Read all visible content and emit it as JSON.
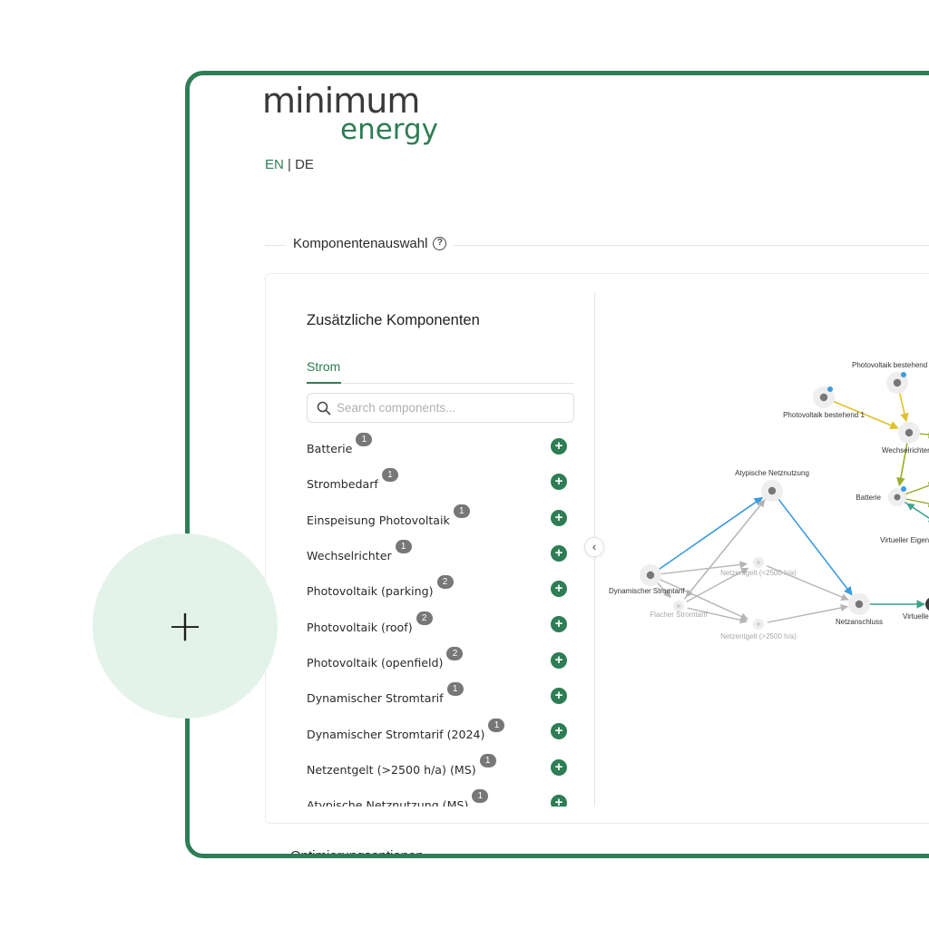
{
  "logo": {
    "line1": "minimum",
    "line2": "energy"
  },
  "language": {
    "en": "EN",
    "separator": " | ",
    "de": "DE"
  },
  "section": {
    "title": "Komponentenauswahl",
    "help_icon": "?"
  },
  "panel": {
    "title": "Zusätzliche Komponenten",
    "tabs": [
      {
        "label": "Strom",
        "active": true
      }
    ],
    "search_placeholder": "Search components...",
    "components": [
      {
        "name": "Batterie",
        "count": "1"
      },
      {
        "name": "Strombedarf",
        "count": "1"
      },
      {
        "name": "Einspeisung Photovoltaik",
        "count": "1"
      },
      {
        "name": "Wechselrichter",
        "count": "1"
      },
      {
        "name": "Photovoltaik (parking)",
        "count": "2"
      },
      {
        "name": "Photovoltaik (roof)",
        "count": "2"
      },
      {
        "name": "Photovoltaik (openfield)",
        "count": "2"
      },
      {
        "name": "Dynamischer Stromtarif",
        "count": "1"
      },
      {
        "name": "Dynamischer Stromtarif (2024)",
        "count": "1"
      },
      {
        "name": "Netzentgelt (>2500 h/a) (MS)",
        "count": "1"
      },
      {
        "name": "Atypische Netznutzung (MS)",
        "count": "1"
      }
    ],
    "collapse_icon": "‹"
  },
  "graph": {
    "nodes": {
      "pv_bestehend": "Photovoltaik bestehend",
      "pv_bestehend_1": "Photovoltaik bestehend 1",
      "wechselrichter": "Wechselrichter",
      "batterie": "Batterie",
      "atypische": "Atypische Netznutzung",
      "virtueller_eigen": "Virtueller Eigen",
      "netzentgelt_low": "Netzentgelt (<2500 h/a)",
      "dynamischer": "Dynamischer Stromtarif",
      "flacher": "Flacher Stromtarif",
      "netzanschluss": "Netzanschluss",
      "virtueller": "Virtueller",
      "netzentgelt_high": "Netzentgelt (>2500 h/a)"
    },
    "colors": {
      "blue": "#3b9be0",
      "gray": "#b5b5b5",
      "yellow": "#e0c030",
      "olive": "#9aad2a",
      "teal": "#3aa38a",
      "node": "#eeeeee",
      "node_dark": "#3a3a3a"
    }
  },
  "bottom": {
    "section_title": "Optimierungsoptionen"
  },
  "floating": {
    "plus": "+"
  }
}
